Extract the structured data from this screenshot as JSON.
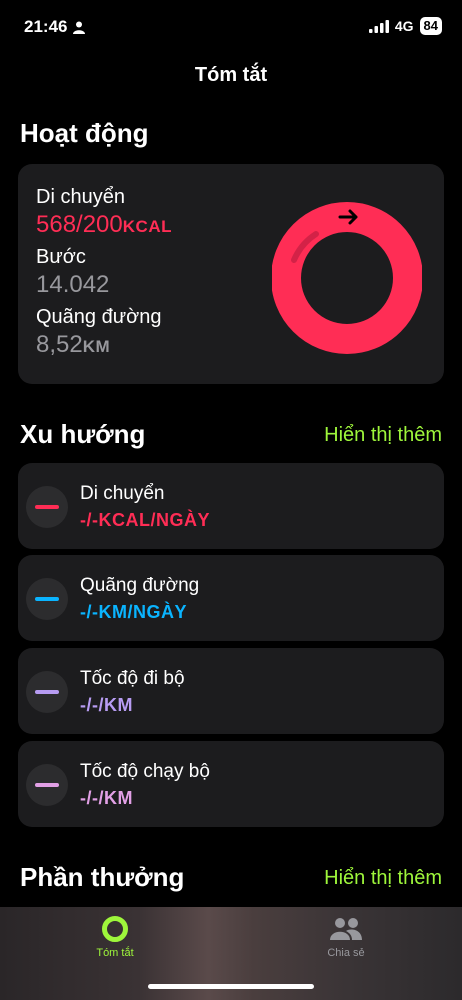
{
  "status": {
    "time": "21:46",
    "network": "4G",
    "battery": "84"
  },
  "nav": {
    "title": "Tóm tắt"
  },
  "activity": {
    "title": "Hoạt động",
    "move_label": "Di chuyển",
    "move_value": "568/200",
    "move_unit": "KCAL",
    "steps_label": "Bước",
    "steps_value": "14.042",
    "distance_label": "Quãng đường",
    "distance_value": "8,52",
    "distance_unit": "KM",
    "move_progress": 2.84
  },
  "trends": {
    "title": "Xu hướng",
    "show_more": "Hiển thị thêm",
    "items": [
      {
        "label": "Di chuyển",
        "value": "-/-KCAL/NGÀY",
        "color": "#ff2d55"
      },
      {
        "label": "Quãng đường",
        "value": "-/-KM/NGÀY",
        "color": "#0ab4ff"
      },
      {
        "label": "Tốc độ đi bộ",
        "value": "-/-/KM",
        "color": "#b79cf2"
      },
      {
        "label": "Tốc độ chạy bộ",
        "value": "-/-/KM",
        "color": "#e2a0e6"
      }
    ]
  },
  "awards": {
    "title": "Phần thưởng",
    "show_more": "Hiển thị thêm"
  },
  "tabbar": {
    "summary": "Tóm tắt",
    "share": "Chia sẻ"
  },
  "colors": {
    "accent": "#9ef63b",
    "move": "#ff2d55"
  }
}
